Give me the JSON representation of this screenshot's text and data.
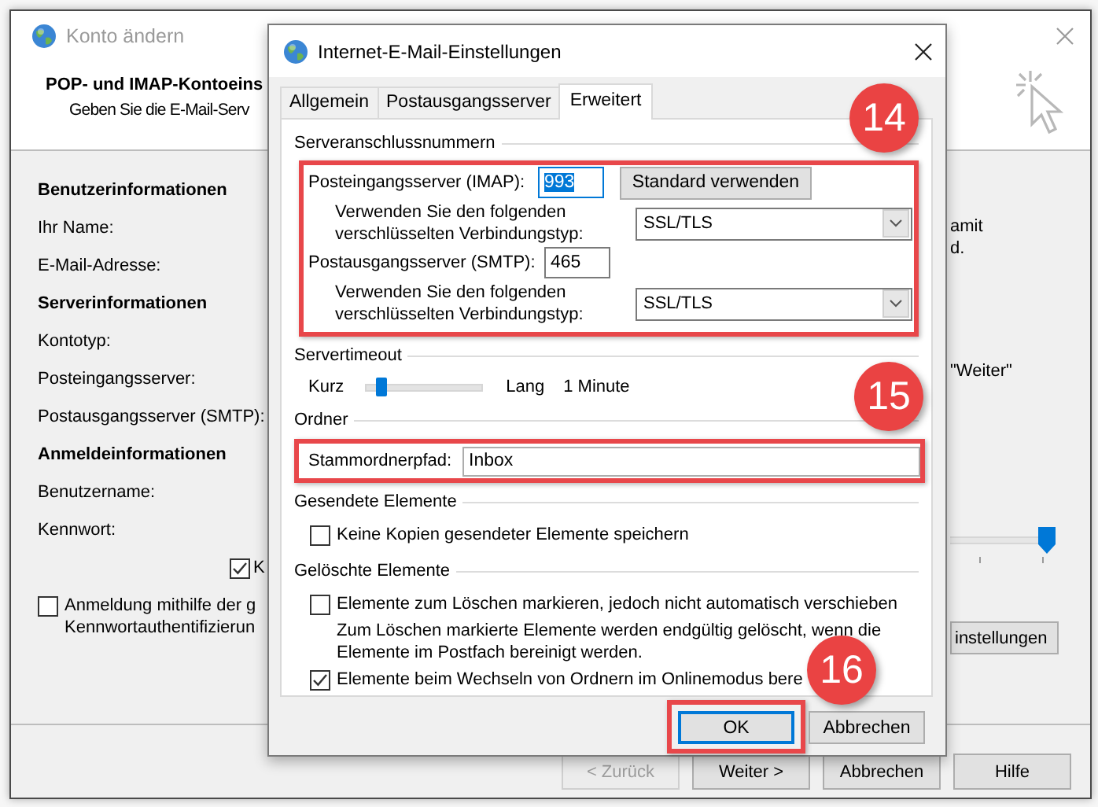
{
  "background_window": {
    "title": "Konto ändern",
    "heading": "POP- und IMAP-Kontoeins",
    "subheading": "Geben Sie die E-Mail-Serv",
    "form_rows": [
      {
        "kind": "heading",
        "text": "Benutzerinformationen"
      },
      {
        "kind": "label",
        "text": "Ihr Name:"
      },
      {
        "kind": "label",
        "text": "E-Mail-Adresse:"
      },
      {
        "kind": "heading",
        "text": "Serverinformationen"
      },
      {
        "kind": "label",
        "text": "Kontotyp:"
      },
      {
        "kind": "label",
        "text": "Posteingangsserver:"
      },
      {
        "kind": "label",
        "text": "Postausgangsserver (SMTP):"
      },
      {
        "kind": "heading",
        "text": "Anmeldeinformationen"
      },
      {
        "kind": "label",
        "text": "Benutzername:"
      },
      {
        "kind": "label",
        "text": "Kennwort:"
      }
    ],
    "remember_checkbox": {
      "label": "K",
      "checked": true
    },
    "spa_checkbox": {
      "label_lines": [
        "Anmeldung mithilfe der g",
        "Kennwortauthentifizierun"
      ],
      "checked": false
    },
    "note_fragments": [
      "amit",
      "d."
    ],
    "next_hint": "\"Weiter\"",
    "slider": {
      "level": 1
    },
    "settings_button": "instellungen",
    "buttons": [
      {
        "label": "< Zurück",
        "disabled": true
      },
      {
        "label": "Weiter >",
        "disabled": false
      },
      {
        "label": "Abbrechen",
        "disabled": false
      },
      {
        "label": "Hilfe",
        "disabled": false
      }
    ]
  },
  "dialog": {
    "title": "Internet-E-Mail-Einstellungen",
    "tabs": [
      {
        "label": "Allgemein",
        "selected": false
      },
      {
        "label": "Postausgangsserver",
        "selected": false
      },
      {
        "label": "Erweitert",
        "selected": true
      }
    ],
    "server_ports": {
      "title": "Serveranschlussnummern",
      "highlighted": true,
      "callout": "14",
      "incoming": {
        "label": "Posteingangsserver (IMAP):",
        "value": "993",
        "value_selected": true,
        "default_button": "Standard verwenden",
        "encryption_label_lines": [
          "Verwenden Sie den folgenden",
          "verschlüsselten Verbindungstyp:"
        ],
        "encryption": "SSL/TLS"
      },
      "outgoing": {
        "label": "Postausgangsserver (SMTP):",
        "value": "465",
        "value_selected": false,
        "encryption_label_lines": [
          "Verwenden Sie den folgenden",
          "verschlüsselten Verbindungstyp:"
        ],
        "encryption": "SSL/TLS"
      }
    },
    "timeout": {
      "title": "Servertimeout",
      "min_label": "Kurz",
      "max_label": "Lang",
      "level": 0.1,
      "reading": "1 Minute"
    },
    "folders": {
      "title": "Ordner",
      "highlighted": true,
      "callout": "15",
      "root_label": "Stammordnerpfad:",
      "root_value": "Inbox"
    },
    "sent_items": {
      "title": "Gesendete Elemente",
      "options": [
        {
          "label": "Keine Kopien gesendeter Elemente speichern",
          "checked": false
        }
      ]
    },
    "deleted_items": {
      "title": "Gelöschte Elemente",
      "options": [
        {
          "label": "Elemente zum Löschen markieren, jedoch nicht automatisch verschieben",
          "checked": false,
          "note_lines": [
            "Zum Löschen markierte Elemente werden endgültig gelöscht, wenn die",
            "Elemente im Postfach bereinigt werden."
          ]
        },
        {
          "label": "Elemente beim Wechseln von Ordnern im Onlinemodus bere",
          "checked": true
        }
      ]
    },
    "buttons": [
      {
        "label": "OK",
        "default": true,
        "highlighted": true,
        "callout": "16"
      },
      {
        "label": "Abbrechen",
        "default": false,
        "highlighted": false
      }
    ]
  }
}
